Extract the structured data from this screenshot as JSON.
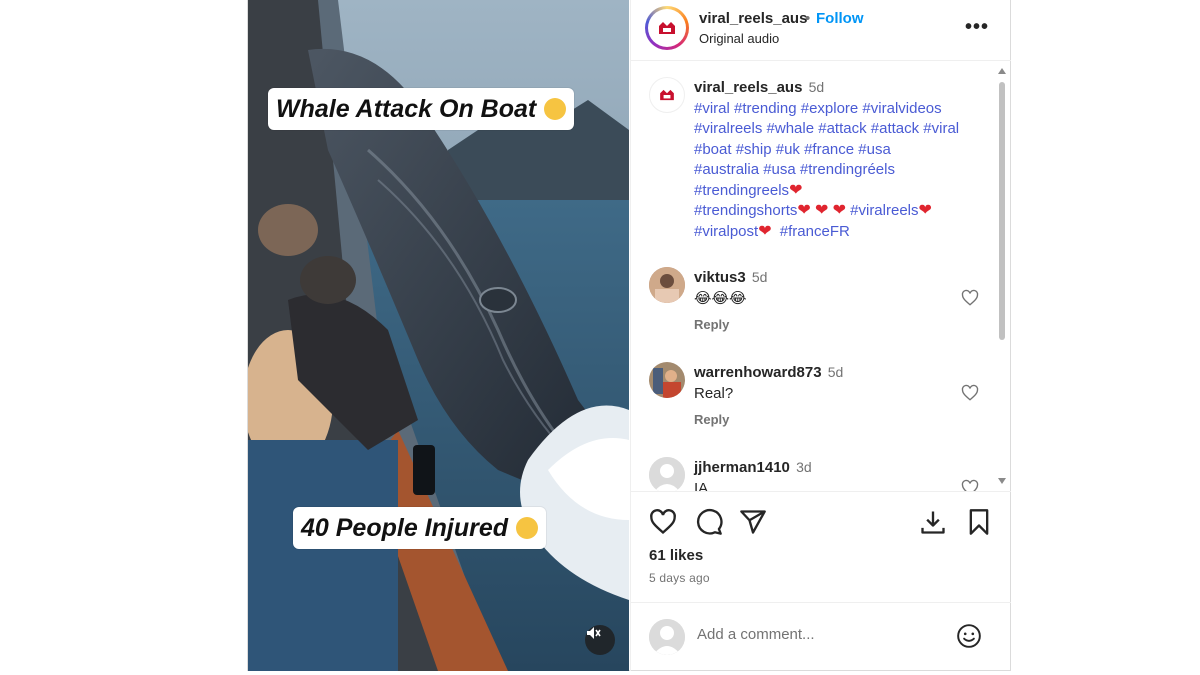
{
  "video": {
    "caption_top": "Whale Attack On Boat",
    "caption_bottom": "40 People Injured",
    "mute_icon": "speaker-muted-icon"
  },
  "header": {
    "username": "viral_reels_aus",
    "separator": "•",
    "follow_label": "Follow",
    "audio": "Original audio",
    "more_icon": "more-options-icon"
  },
  "post": {
    "username": "viral_reels_aus",
    "time": "5d",
    "lines": [
      "#viral #trending #explore #viralvideos",
      "#viralreels #whale #attack #attack #viral",
      "#boat #ship #uk #france #usa",
      "#australia #usa #trendingréels",
      "#trendingreels",
      "#trendingshorts",
      "#viralreels",
      "#viralpost",
      "#franceFR"
    ]
  },
  "comments": [
    {
      "username": "viktus3",
      "time": "5d",
      "text": "😂😂😂",
      "reply": "Reply"
    },
    {
      "username": "warrenhoward873",
      "time": "5d",
      "text": "Real?",
      "reply": "Reply"
    },
    {
      "username": "jjherman1410",
      "time": "3d",
      "text": "IA"
    }
  ],
  "actions": {
    "likes": "61 likes",
    "ago": "5 days ago"
  },
  "add_comment": {
    "placeholder": "Add a comment..."
  },
  "colors": {
    "accent": "#0095f6",
    "hashtag": "#4a5bd4",
    "heart": "#e0252f"
  }
}
